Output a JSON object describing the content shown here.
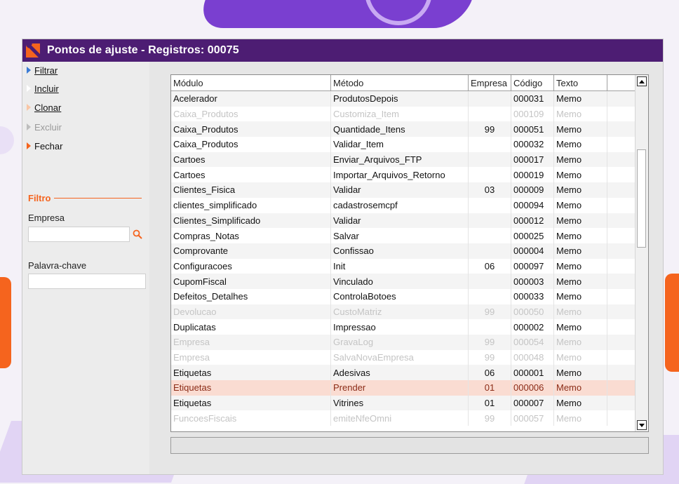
{
  "window": {
    "title": "Pontos de ajuste - Registros: 00075"
  },
  "actions": [
    {
      "label": "Filtrar",
      "state": "enabled",
      "color": "#3a7bd5"
    },
    {
      "label": "Incluir",
      "state": "enabled",
      "color": "#ffffff"
    },
    {
      "label": "Clonar",
      "state": "enabled",
      "color": "#f9c6a6"
    },
    {
      "label": "Excluir",
      "state": "disabled",
      "color": "#bdbdbd"
    },
    {
      "label": "Fechar",
      "state": "enabled",
      "color": "#f5641e"
    }
  ],
  "filter": {
    "heading": "Filtro",
    "empresa_label": "Empresa",
    "empresa_value": "",
    "palavra_label": "Palavra-chave",
    "palavra_value": ""
  },
  "grid": {
    "columns": [
      "Módulo",
      "Método",
      "Empresa",
      "Código",
      "Texto"
    ],
    "rows": [
      {
        "modulo": "Acelerador",
        "metodo": "ProdutosDepois",
        "empresa": "",
        "codigo": "000031",
        "texto": "Memo",
        "state": "normal"
      },
      {
        "modulo": "Caixa_Produtos",
        "metodo": "Customiza_Item",
        "empresa": "",
        "codigo": "000109",
        "texto": "Memo",
        "state": "disabled"
      },
      {
        "modulo": "Caixa_Produtos",
        "metodo": "Quantidade_Itens",
        "empresa": "99",
        "codigo": "000051",
        "texto": "Memo",
        "state": "normal"
      },
      {
        "modulo": "Caixa_Produtos",
        "metodo": "Validar_Item",
        "empresa": "",
        "codigo": "000032",
        "texto": "Memo",
        "state": "normal"
      },
      {
        "modulo": "Cartoes",
        "metodo": "Enviar_Arquivos_FTP",
        "empresa": "",
        "codigo": "000017",
        "texto": "Memo",
        "state": "normal"
      },
      {
        "modulo": "Cartoes",
        "metodo": "Importar_Arquivos_Retorno",
        "empresa": "",
        "codigo": "000019",
        "texto": "Memo",
        "state": "normal"
      },
      {
        "modulo": "Clientes_Fisica",
        "metodo": "Validar",
        "empresa": "03",
        "codigo": "000009",
        "texto": "Memo",
        "state": "normal"
      },
      {
        "modulo": "clientes_simplificado",
        "metodo": "cadastrosemcpf",
        "empresa": "",
        "codigo": "000094",
        "texto": "Memo",
        "state": "normal"
      },
      {
        "modulo": "Clientes_Simplificado",
        "metodo": "Validar",
        "empresa": "",
        "codigo": "000012",
        "texto": "Memo",
        "state": "normal"
      },
      {
        "modulo": "Compras_Notas",
        "metodo": "Salvar",
        "empresa": "",
        "codigo": "000025",
        "texto": "Memo",
        "state": "normal"
      },
      {
        "modulo": "Comprovante",
        "metodo": "Confissao",
        "empresa": "",
        "codigo": "000004",
        "texto": "Memo",
        "state": "normal"
      },
      {
        "modulo": "Configuracoes",
        "metodo": "Init",
        "empresa": "06",
        "codigo": "000097",
        "texto": "Memo",
        "state": "normal"
      },
      {
        "modulo": "CupomFiscal",
        "metodo": "Vinculado",
        "empresa": "",
        "codigo": "000003",
        "texto": "Memo",
        "state": "normal"
      },
      {
        "modulo": "Defeitos_Detalhes",
        "metodo": "ControlaBotoes",
        "empresa": "",
        "codigo": "000033",
        "texto": "Memo",
        "state": "normal"
      },
      {
        "modulo": "Devolucao",
        "metodo": "CustoMatriz",
        "empresa": "99",
        "codigo": "000050",
        "texto": "Memo",
        "state": "disabled"
      },
      {
        "modulo": "Duplicatas",
        "metodo": "Impressao",
        "empresa": "",
        "codigo": "000002",
        "texto": "Memo",
        "state": "normal"
      },
      {
        "modulo": "Empresa",
        "metodo": "GravaLog",
        "empresa": "99",
        "codigo": "000054",
        "texto": "Memo",
        "state": "disabled"
      },
      {
        "modulo": "Empresa",
        "metodo": "SalvaNovaEmpresa",
        "empresa": "99",
        "codigo": "000048",
        "texto": "Memo",
        "state": "disabled"
      },
      {
        "modulo": "Etiquetas",
        "metodo": "Adesivas",
        "empresa": "06",
        "codigo": "000001",
        "texto": "Memo",
        "state": "normal"
      },
      {
        "modulo": "Etiquetas",
        "metodo": "Prender",
        "empresa": "01",
        "codigo": "000006",
        "texto": "Memo",
        "state": "selected"
      },
      {
        "modulo": "Etiquetas",
        "metodo": "Vitrines",
        "empresa": "01",
        "codigo": "000007",
        "texto": "Memo",
        "state": "normal"
      },
      {
        "modulo": "FuncoesFiscais",
        "metodo": "emiteNfeOmni",
        "empresa": "99",
        "codigo": "000057",
        "texto": "Memo",
        "state": "disabled"
      }
    ]
  }
}
